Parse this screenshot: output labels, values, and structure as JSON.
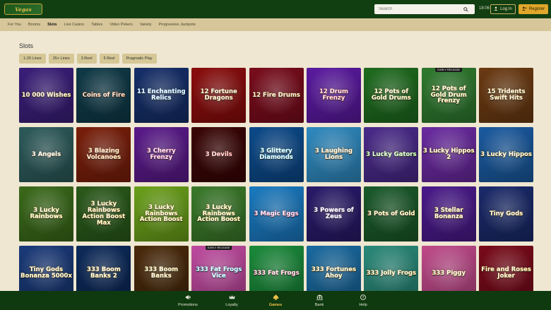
{
  "header": {
    "logo_text": "Vegas",
    "search_placeholder": "Search",
    "time": "18:06",
    "login_label": "Log In",
    "register_label": "Register"
  },
  "nav": {
    "items": [
      "For You",
      "Booms",
      "Slots",
      "Live Casino",
      "Tables",
      "Video Pokers",
      "Variety",
      "Progressive Jackpots"
    ],
    "active": "Slots"
  },
  "page": {
    "title": "Slots",
    "filters": [
      "1-20 Lines",
      "25+ Lines",
      "3 Reel",
      "5 Reel",
      "Pragmatic Play"
    ]
  },
  "games": [
    {
      "name": "10 000 Wishes",
      "color": "#3b1e7a",
      "accent": "#e7c04b"
    },
    {
      "name": "Coins of Fire",
      "color": "#0f3a48",
      "accent": "#e06a1c"
    },
    {
      "name": "11 Enchanting Relics",
      "color": "#162f6a",
      "accent": "#7fd0ff"
    },
    {
      "name": "12 Fortune Dragons",
      "color": "#8b0d0d",
      "accent": "#e7b24a"
    },
    {
      "name": "12 Fire Drums",
      "color": "#7a0c1c",
      "accent": "#f0b030"
    },
    {
      "name": "12 Drum Frenzy",
      "color": "#5a1aa0",
      "accent": "#ff4a4a"
    },
    {
      "name": "12 Pots of Gold Drums",
      "color": "#1e6b1e",
      "accent": "#e7d04b"
    },
    {
      "name": "12 Pots of Gold Drum Frenzy",
      "color": "#2f7a2f",
      "accent": "#ffd54a",
      "badge": "EARLY RELEASE"
    },
    {
      "name": "15 Tridents Swift Hits",
      "color": "#6b3a12",
      "accent": "#f0c24a"
    },
    {
      "name": "3 Angels",
      "color": "#2d5a5a",
      "accent": "#f0d8a0"
    },
    {
      "name": "3 Blazing Volcanoes",
      "color": "#7a1f0a",
      "accent": "#ff9a2a"
    },
    {
      "name": "3 Cherry Frenzy",
      "color": "#5a1a8a",
      "accent": "#ff5aa0"
    },
    {
      "name": "3 Devils",
      "color": "#3a0505",
      "accent": "#ff3a2a"
    },
    {
      "name": "3 Glittery Diamonds",
      "color": "#0c4a8a",
      "accent": "#7ff0ff"
    },
    {
      "name": "3 Laughing Lions",
      "color": "#2f8ac0",
      "accent": "#ffcc66"
    },
    {
      "name": "3 Lucky Gators",
      "color": "#4a2a8a",
      "accent": "#7fe04a"
    },
    {
      "name": "3 Lucky Hippos 2",
      "color": "#6a2aa0",
      "accent": "#ffd54a"
    },
    {
      "name": "3 Lucky Hippos",
      "color": "#1a5aa0",
      "accent": "#ffd54a"
    },
    {
      "name": "3 Lucky Rainbows",
      "color": "#3a6a1a",
      "accent": "#ffe04a"
    },
    {
      "name": "3 Lucky Rainbows Action Boost Max",
      "color": "#2a5a1a",
      "accent": "#ffcc33"
    },
    {
      "name": "3 Lucky Rainbows Action Boost",
      "color": "#6aa01a",
      "accent": "#ffd54a"
    },
    {
      "name": "3 Lucky Rainbows Action Boost",
      "color": "#3a7a2a",
      "accent": "#ffe04a"
    },
    {
      "name": "3 Magic Eggs",
      "color": "#1a7ac0",
      "accent": "#ff7ac0"
    },
    {
      "name": "3 Powers of Zeus",
      "color": "#2a1a6a",
      "accent": "#e7d0ff"
    },
    {
      "name": "3 Pots of Gold",
      "color": "#1a5a2a",
      "accent": "#ffd54a"
    },
    {
      "name": "3 Stellar Bonanza",
      "color": "#4a1a8a",
      "accent": "#ffd54a"
    },
    {
      "name": "Tiny Gods",
      "color": "#1a2a6a",
      "accent": "#ffd54a"
    },
    {
      "name": "Tiny Gods Bonanza 5000x",
      "color": "#1a3a7a",
      "accent": "#ffd54a"
    },
    {
      "name": "333 Boom Banks 2",
      "color": "#0c2a5a",
      "accent": "#ffd54a"
    },
    {
      "name": "333 Boom Banks",
      "color": "#4a2a0a",
      "accent": "#ffd54a"
    },
    {
      "name": "333 Fat Frogs Vice",
      "color": "#c04aa0",
      "accent": "#6ae0ff",
      "badge": "EARLY RELEASE"
    },
    {
      "name": "333 Fat Frogs",
      "color": "#1a8a3a",
      "accent": "#ff7aa0"
    },
    {
      "name": "333 Fortunes Ahoy",
      "color": "#1a6aa0",
      "accent": "#ffd54a"
    },
    {
      "name": "333 Jolly Frogs",
      "color": "#2a8a7a",
      "accent": "#ffd54a"
    },
    {
      "name": "333 Piggy",
      "color": "#c04a8a",
      "accent": "#ffd54a"
    },
    {
      "name": "Fire and Roses Joker",
      "color": "#7a0a1a",
      "accent": "#ffcc33"
    }
  ],
  "bottom_nav": [
    {
      "label": "Promotions",
      "icon": "megaphone-icon"
    },
    {
      "label": "Loyalty",
      "icon": "crown-icon"
    },
    {
      "label": "Games",
      "icon": "spade-icon"
    },
    {
      "label": "Bank",
      "icon": "bank-icon"
    },
    {
      "label": "Help",
      "icon": "help-icon"
    }
  ],
  "bottom_nav_active": "Games"
}
